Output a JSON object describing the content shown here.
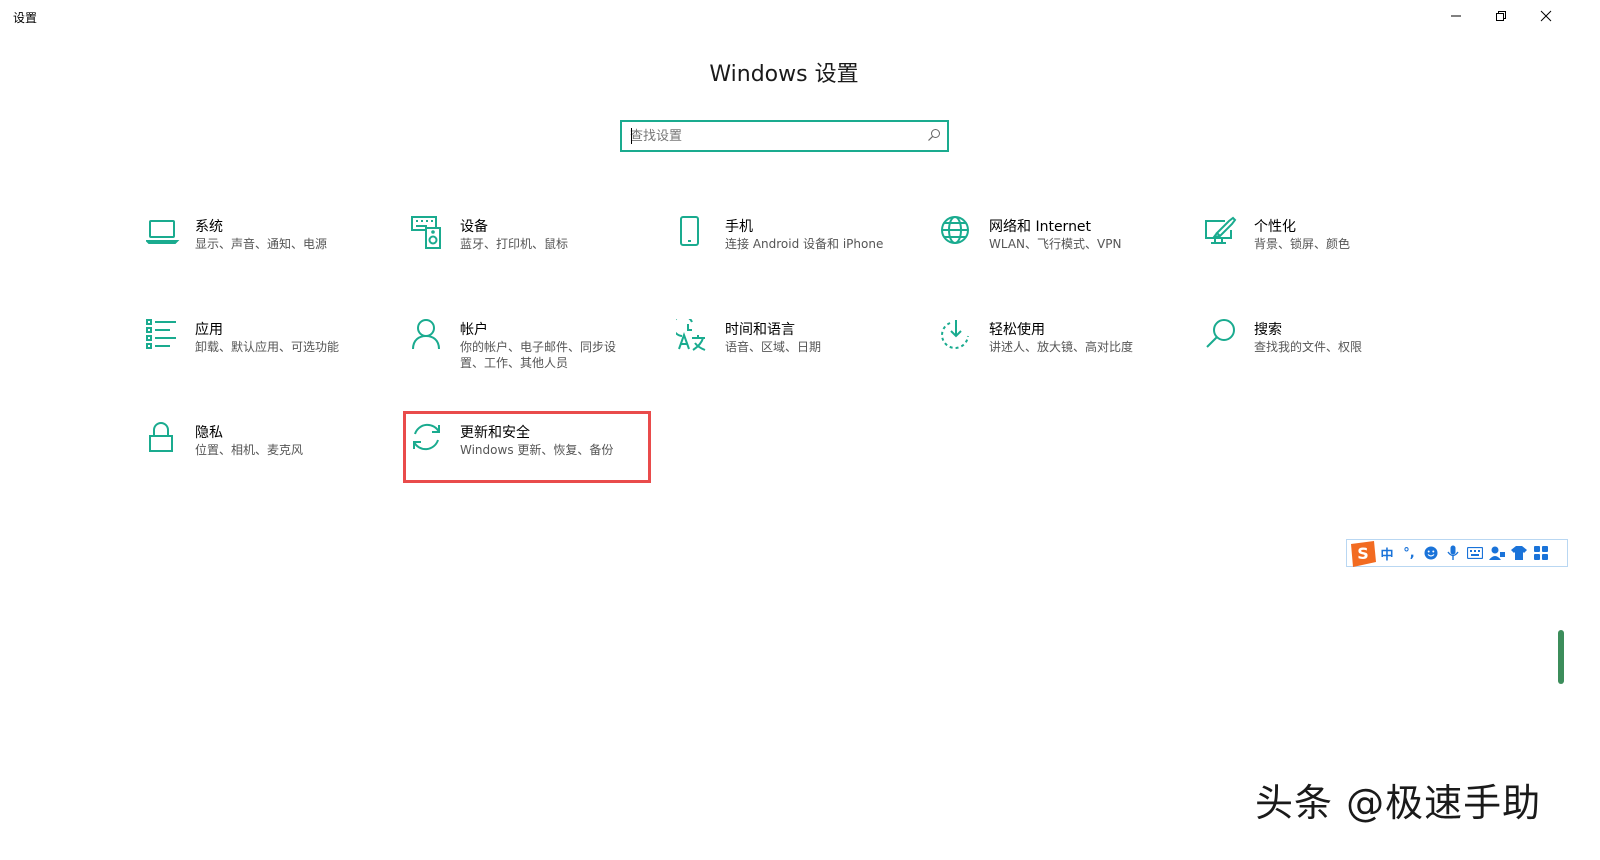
{
  "window": {
    "title": "设置",
    "minimize_icon": "minimize-icon",
    "restore_icon": "restore-icon",
    "close_icon": "close-icon"
  },
  "page": {
    "title": "Windows 设置"
  },
  "search": {
    "placeholder": "查找设置",
    "value": "",
    "icon": "search-icon"
  },
  "accent_color": "#1aab8f",
  "highlight_color": "#e94b4b",
  "tiles": [
    {
      "title": "系统",
      "desc": "显示、声音、通知、电源",
      "icon": "laptop-icon"
    },
    {
      "title": "设备",
      "desc": "蓝牙、打印机、鼠标",
      "icon": "keyboard-speaker-icon"
    },
    {
      "title": "手机",
      "desc": "连接 Android 设备和 iPhone",
      "icon": "phone-icon"
    },
    {
      "title": "网络和 Internet",
      "desc": "WLAN、飞行模式、VPN",
      "icon": "globe-icon"
    },
    {
      "title": "个性化",
      "desc": "背景、锁屏、颜色",
      "icon": "paint-pen-icon"
    },
    {
      "title": "应用",
      "desc": "卸载、默认应用、可选功能",
      "icon": "app-list-icon"
    },
    {
      "title": "帐户",
      "desc": "你的帐户、电子邮件、同步设置、工作、其他人员",
      "icon": "person-icon"
    },
    {
      "title": "时间和语言",
      "desc": "语音、区域、日期",
      "icon": "time-language-icon"
    },
    {
      "title": "轻松使用",
      "desc": "讲述人、放大镜、高对比度",
      "icon": "ease-of-access-icon"
    },
    {
      "title": "搜索",
      "desc": "查找我的文件、权限",
      "icon": "magnifier-icon"
    },
    {
      "title": "隐私",
      "desc": "位置、相机、麦克风",
      "icon": "lock-icon"
    },
    {
      "title": "更新和安全",
      "desc": "Windows 更新、恢复、备份",
      "icon": "sync-icon"
    }
  ],
  "ime_toolbar": {
    "logo": "sogou-logo-icon",
    "mode_label": "中",
    "punct_label": "°,",
    "items": [
      "emoji-icon",
      "microphone-icon",
      "keyboard-icon",
      "user-icon",
      "skin-icon",
      "grid-icon"
    ]
  },
  "watermark": "头条 @极速手助"
}
